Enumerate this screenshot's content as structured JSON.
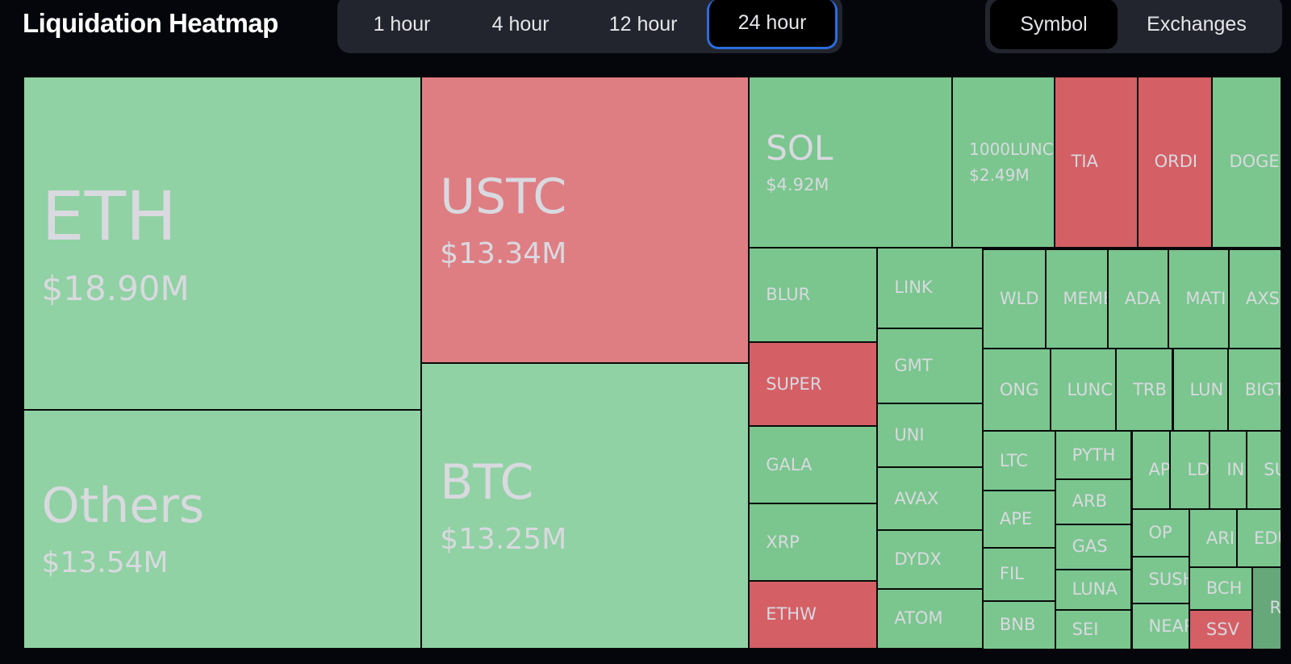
{
  "header": {
    "title": "Liquidation Heatmap",
    "time_tabs": [
      {
        "label": "1 hour",
        "active": false
      },
      {
        "label": "4 hour",
        "active": false
      },
      {
        "label": "12 hour",
        "active": false
      },
      {
        "label": "24 hour",
        "active": true
      }
    ],
    "view_tabs": [
      {
        "label": "Symbol",
        "active": true
      },
      {
        "label": "Exchanges",
        "active": false
      }
    ]
  },
  "colors": {
    "background": "#05060b",
    "green_light": "#90d2a3",
    "red_light": "#de7e83",
    "green": "#7ac68e",
    "red": "#d45f65",
    "green_dark": "#66a87a",
    "active_border": "#2b6de0"
  },
  "cells": [
    {
      "symbol": "ETH",
      "value": "$18.90M",
      "tone": "green_light"
    },
    {
      "symbol": "Others",
      "value": "$13.54M",
      "tone": "green_light"
    },
    {
      "symbol": "USTC",
      "value": "$13.34M",
      "tone": "red_light"
    },
    {
      "symbol": "BTC",
      "value": "$13.25M",
      "tone": "green_light"
    },
    {
      "symbol": "SOL",
      "value": "$4.92M",
      "tone": "green"
    },
    {
      "symbol": "1000LUNC",
      "value": "$2.49M",
      "tone": "green"
    },
    {
      "symbol": "TIA",
      "tone": "red"
    },
    {
      "symbol": "ORDI",
      "tone": "red"
    },
    {
      "symbol": "DOGE",
      "tone": "green"
    },
    {
      "symbol": "BLUR",
      "tone": "green"
    },
    {
      "symbol": "SUPER",
      "tone": "red"
    },
    {
      "symbol": "GALA",
      "tone": "green"
    },
    {
      "symbol": "XRP",
      "tone": "green"
    },
    {
      "symbol": "ETHW",
      "tone": "red"
    },
    {
      "symbol": "LINK",
      "tone": "green"
    },
    {
      "symbol": "GMT",
      "tone": "green"
    },
    {
      "symbol": "UNI",
      "tone": "green"
    },
    {
      "symbol": "AVAX",
      "tone": "green"
    },
    {
      "symbol": "DYDX",
      "tone": "green"
    },
    {
      "symbol": "ATOM",
      "tone": "green"
    },
    {
      "symbol": "WLD",
      "tone": "green"
    },
    {
      "symbol": "MEME",
      "tone": "green"
    },
    {
      "symbol": "ADA",
      "tone": "green"
    },
    {
      "symbol": "MATI",
      "tone": "green"
    },
    {
      "symbol": "AXS",
      "tone": "green"
    },
    {
      "symbol": "ONG",
      "tone": "green"
    },
    {
      "symbol": "LUNC",
      "tone": "green"
    },
    {
      "symbol": "TRB",
      "tone": "green"
    },
    {
      "symbol": "LUN",
      "tone": "green"
    },
    {
      "symbol": "BIGT",
      "tone": "green"
    },
    {
      "symbol": "LTC",
      "tone": "green"
    },
    {
      "symbol": "APE",
      "tone": "green"
    },
    {
      "symbol": "FIL",
      "tone": "green"
    },
    {
      "symbol": "BNB",
      "tone": "green"
    },
    {
      "symbol": "PYTH",
      "tone": "green"
    },
    {
      "symbol": "ARB",
      "tone": "green"
    },
    {
      "symbol": "GAS",
      "tone": "green"
    },
    {
      "symbol": "LUNA",
      "tone": "green"
    },
    {
      "symbol": "SEI",
      "tone": "green"
    },
    {
      "symbol": "AP",
      "tone": "green"
    },
    {
      "symbol": "LD",
      "tone": "green"
    },
    {
      "symbol": "IN",
      "tone": "green"
    },
    {
      "symbol": "SU",
      "tone": "green"
    },
    {
      "symbol": "OP",
      "tone": "green"
    },
    {
      "symbol": "SUSH",
      "tone": "green"
    },
    {
      "symbol": "NEAR",
      "tone": "green"
    },
    {
      "symbol": "ARI",
      "tone": "green"
    },
    {
      "symbol": "EDU",
      "tone": "green"
    },
    {
      "symbol": "BCH",
      "tone": "green"
    },
    {
      "symbol": "SSV",
      "tone": "red"
    },
    {
      "symbol": "R",
      "tone": "green_dark"
    }
  ]
}
